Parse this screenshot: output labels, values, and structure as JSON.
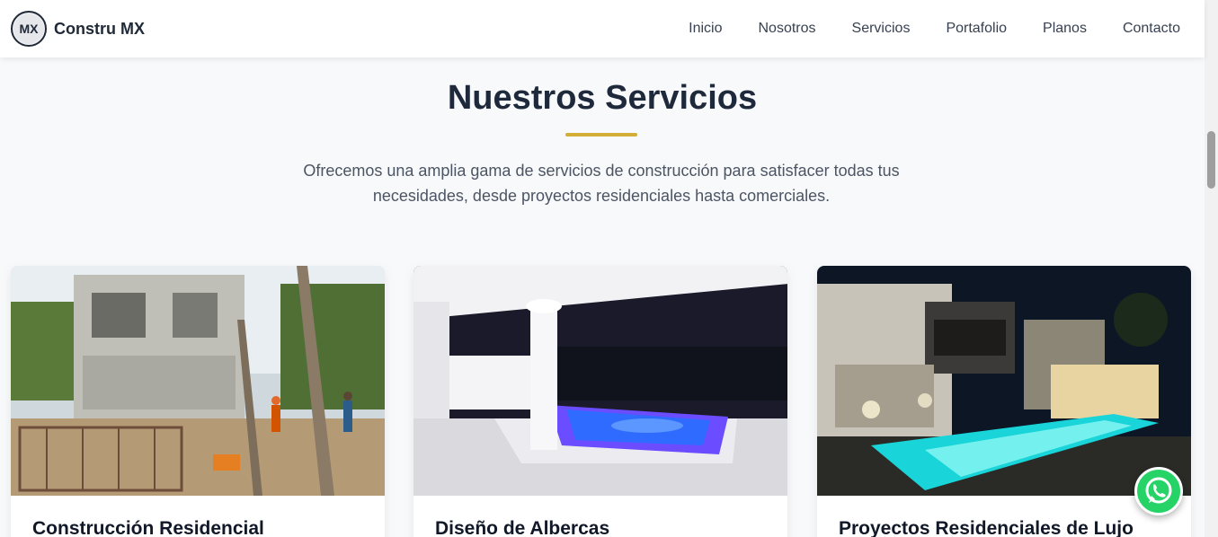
{
  "brand": {
    "name": "Constru MX",
    "logo_text": "MX"
  },
  "nav": {
    "items": [
      "Inicio",
      "Nosotros",
      "Servicios",
      "Portafolio",
      "Planos",
      "Contacto"
    ]
  },
  "section": {
    "title": "Nuestros Servicios",
    "subtitle": "Ofrecemos una amplia gama de servicios de construcción para satisfacer todas tus necesidades, desde proyectos residenciales hasta comerciales."
  },
  "cards": [
    {
      "title": "Construcción Residencial"
    },
    {
      "title": "Diseño de Albercas"
    },
    {
      "title": "Proyectos Residenciales de Lujo"
    }
  ],
  "whatsapp": {
    "icon": "whatsapp-icon"
  },
  "colors": {
    "accent": "#d4af37",
    "heading": "#1e293b",
    "whatsapp": "#25d366"
  }
}
